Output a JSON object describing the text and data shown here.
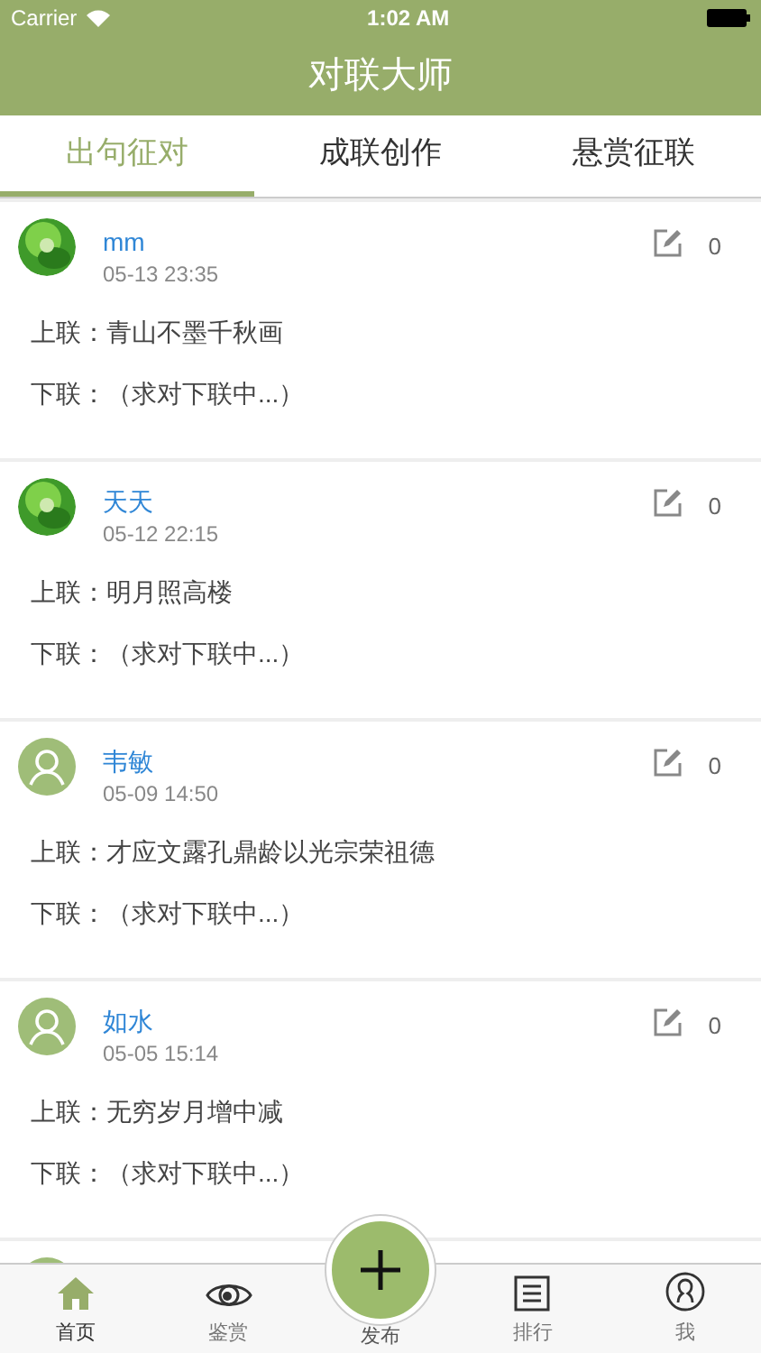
{
  "status_bar": {
    "carrier": "Carrier",
    "time": "1:02 AM"
  },
  "nav": {
    "title": "对联大师"
  },
  "tabs": [
    {
      "label": "出句征对",
      "selected": true
    },
    {
      "label": "成联创作",
      "selected": false
    },
    {
      "label": "悬赏征联",
      "selected": false
    }
  ],
  "posts": [
    {
      "name": "mm",
      "time": "05-13 23:35",
      "count": "0",
      "lines": [
        {
          "label": "上联：",
          "text": "青山不墨千秋画"
        },
        {
          "label": "下联：",
          "text": "（求对下联中...）"
        }
      ]
    },
    {
      "name": "天天",
      "time": "05-12 22:15",
      "count": "0",
      "lines": [
        {
          "label": "上联：",
          "text": "明月照高楼"
        },
        {
          "label": "下联：",
          "text": "（求对下联中...）"
        }
      ]
    },
    {
      "kind": "default",
      "name": "韦敏",
      "time": "05-09 14:50",
      "count": "0",
      "lines": [
        {
          "label": "上联：",
          "text": "才应文露孔鼎龄以光宗荣祖德"
        },
        {
          "label": "下联：",
          "text": "（求对下联中...）"
        }
      ]
    },
    {
      "kind": "default",
      "name": "如水",
      "time": "05-05 15:14",
      "count": "0",
      "lines": [
        {
          "label": "上联：",
          "text": "无穷岁月增中减"
        },
        {
          "label": "下联：",
          "text": "（求对下联中...）"
        }
      ]
    },
    {
      "kind": "default"
    }
  ],
  "tab_bar": [
    {
      "kind": "home",
      "label": "首页",
      "selected": true
    },
    {
      "kind": "eye",
      "label": "鉴赏",
      "selected": false
    },
    {
      "kind": "publish",
      "label": "发布",
      "selected": false
    },
    {
      "kind": "list",
      "label": "排行",
      "selected": false
    },
    {
      "kind": "user",
      "label": "我",
      "selected": false
    }
  ]
}
